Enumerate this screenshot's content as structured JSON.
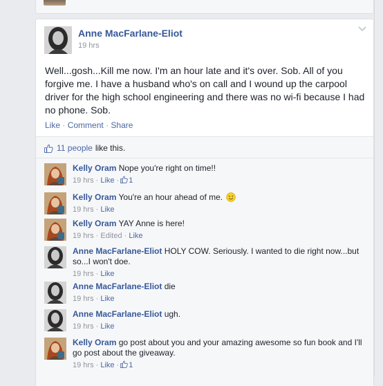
{
  "post": {
    "author": "Anne MacFarlane-Eliot",
    "time": "19 hrs",
    "text": "Well...gosh...Kill me now. I'm an hour late and it's over. Sob. All of you forgive me. I have a husband who's on call and I wound up the carpool driver for the high school engineering and there was no wi-fi because I had no phone. Sob.",
    "actions": {
      "like": "Like",
      "comment": "Comment",
      "share": "Share",
      "separator": "·"
    }
  },
  "likes": {
    "count_text": "11 people",
    "suffix": "like this."
  },
  "comments": [
    {
      "author": "Kelly Oram",
      "text": "Nope you're right on time!!",
      "time": "19 hrs",
      "like": "Like",
      "like_count": "1",
      "edited": ""
    },
    {
      "author": "Kelly Oram",
      "text": "You're an hour ahead of me.",
      "time": "19 hrs",
      "like": "Like",
      "like_count": "",
      "edited": ""
    },
    {
      "author": "Kelly Oram",
      "text": "YAY Anne is here!",
      "time": "19 hrs",
      "like": "Like",
      "like_count": "",
      "edited": "Edited"
    },
    {
      "author": "Anne MacFarlane-Eliot",
      "text": "HOLY COW. Seriously. I wanted to die right now...but so...I won't doe.",
      "time": "19 hrs",
      "like": "Like",
      "like_count": "",
      "edited": ""
    },
    {
      "author": "Anne MacFarlane-Eliot",
      "text": "die",
      "time": "19 hrs",
      "like": "Like",
      "like_count": "",
      "edited": ""
    },
    {
      "author": "Anne MacFarlane-Eliot",
      "text": "ugh.",
      "time": "19 hrs",
      "like": "Like",
      "like_count": "",
      "edited": ""
    },
    {
      "author": "Kelly Oram",
      "text": "go post about you and your amazing awesome so fun book and I'll go post about the giveaway.",
      "time": "19 hrs",
      "like": "Like",
      "like_count": "1",
      "edited": ""
    }
  ],
  "colors": {
    "link": "#365899",
    "meta": "#90949c",
    "text": "#1d2129",
    "ufi_bg": "#f6f7f9",
    "page_bg": "#e9ebee"
  }
}
